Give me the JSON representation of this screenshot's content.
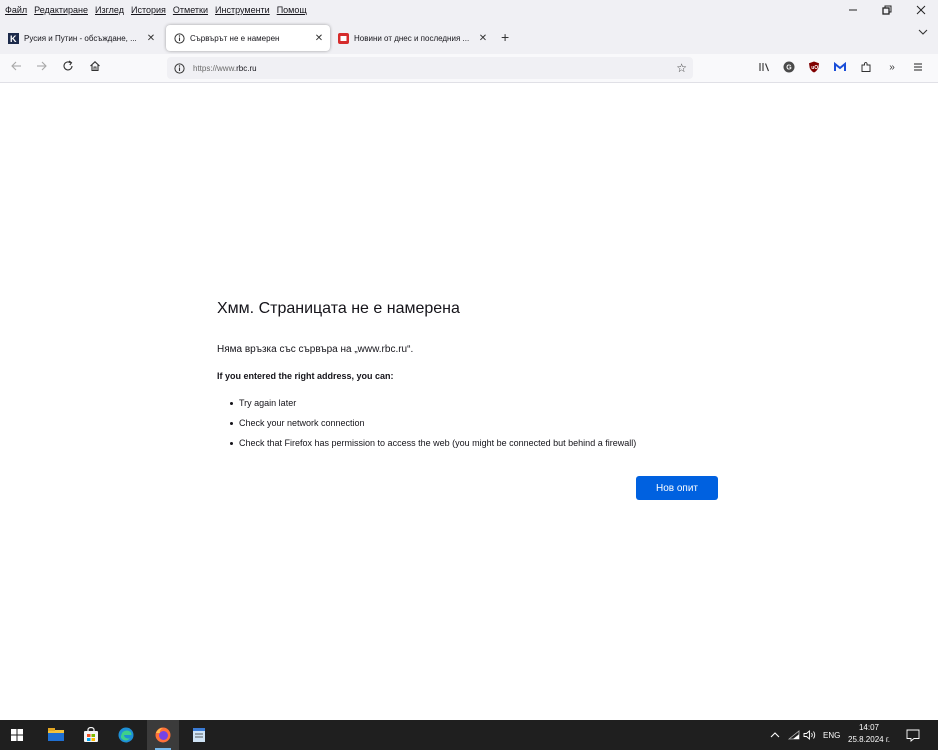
{
  "menu": {
    "items": [
      "Файл",
      "Редактиране",
      "Изглед",
      "История",
      "Отметки",
      "Инструменти",
      "Помощ"
    ]
  },
  "tabs": [
    {
      "label": "Русия и Путин - обсъждане, ...",
      "favicon": "k-site-icon",
      "active": false
    },
    {
      "label": "Сървърът не е намерен",
      "favicon": "info-icon",
      "active": true
    },
    {
      "label": "Новини от днес и последния ...",
      "favicon": "news-site-icon",
      "active": false
    }
  ],
  "url": {
    "prefix": "https://www.",
    "host": "rbc.ru"
  },
  "error": {
    "title": "Хмм. Страницата не е намерена",
    "short_desc": "Няма връзка със сървъра на „www.rbc.ru“.",
    "subtitle": "If you entered the right address, you can:",
    "suggestions": [
      "Try again later",
      "Check your network connection",
      "Check that Firefox has permission to access the web (you might be connected but behind a firewall)"
    ],
    "retry_label": "Нов опит"
  },
  "taskbar": {
    "lang": "ENG",
    "time": "14:07",
    "date": "25.8.2024 г."
  },
  "colors": {
    "accent": "#0061e0",
    "chrome_bg": "#f0f0f4",
    "taskbar_bg": "#1f1f1f"
  }
}
